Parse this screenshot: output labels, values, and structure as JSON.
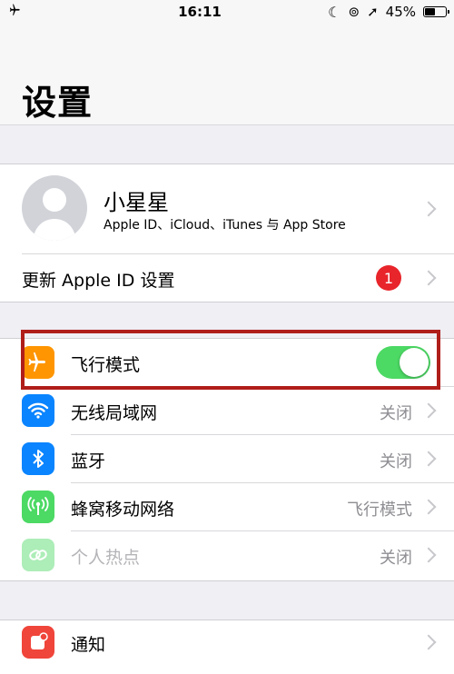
{
  "status_bar": {
    "time": "16:11",
    "battery": "45%",
    "battery_level": 0.45
  },
  "nav": {
    "title": "设置"
  },
  "profile": {
    "name": "小星星",
    "subtitle": "Apple ID、iCloud、iTunes 与 App Store"
  },
  "update": {
    "label": "更新 Apple ID 设置",
    "badge": "1"
  },
  "network": {
    "airplane": {
      "label": "飞行模式",
      "on": true
    },
    "wifi": {
      "label": "无线局域网",
      "value": "关闭"
    },
    "bluetooth": {
      "label": "蓝牙",
      "value": "关闭"
    },
    "cellular": {
      "label": "蜂窝移动网络",
      "value": "飞行模式"
    },
    "hotspot": {
      "label": "个人热点",
      "value": "关闭"
    }
  },
  "notifications": {
    "label": "通知"
  },
  "colors": {
    "airplane": "#ff9500",
    "wifi": "#0a84ff",
    "bluetooth": "#0a84ff",
    "cellular": "#4cd964",
    "hotspot": "#4cd964",
    "notifications": "#f0453a",
    "toggle_on": "#4cd964",
    "badge": "#e8252b",
    "highlight": "#b01e1a"
  }
}
